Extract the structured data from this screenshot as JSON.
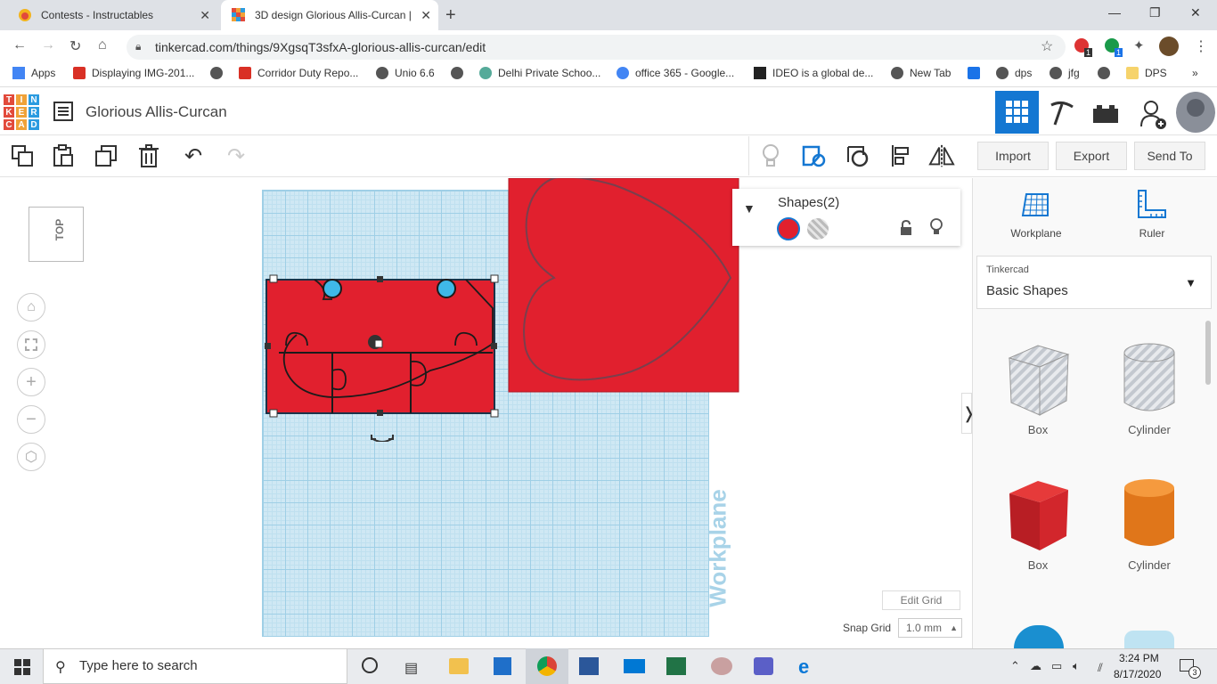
{
  "browser": {
    "tabs": [
      {
        "title": "Contests - Instructables",
        "active": false
      },
      {
        "title": "3D design Glorious Allis-Curcan |",
        "active": true
      }
    ],
    "url": "tinkercad.com/things/9XgsqT3sfxA-glorious-allis-curcan/edit",
    "bookmarks": [
      "Apps",
      "Displaying IMG-201...",
      "Corridor Duty Repo...",
      "Unio 6.6",
      "Delhi Private Schoo...",
      "office 365 - Google...",
      "IDEO is a global de...",
      "New Tab",
      "dps",
      "jfg",
      "DPS"
    ],
    "badges": [
      "1",
      "1"
    ]
  },
  "app": {
    "logo_letters": [
      "T",
      "I",
      "N",
      "K",
      "E",
      "R",
      "C",
      "A",
      "D"
    ],
    "logo_colors": [
      "#e24a3b",
      "#f0a238",
      "#2b9be0",
      "#e24a3b",
      "#f0a238",
      "#2b9be0",
      "#e24a3b",
      "#f0a238",
      "#2b9be0"
    ],
    "design_title": "Glorious Allis-Curcan",
    "accent": "#1477d2"
  },
  "toolbar": {
    "import_label": "Import",
    "export_label": "Export",
    "send_to_label": "Send To"
  },
  "canvas": {
    "view_label": "TOP",
    "workplane_label": "Workplane",
    "edit_grid_label": "Edit Grid",
    "snap_grid_label": "Snap Grid",
    "snap_grid_value": "1.0 mm"
  },
  "inspector": {
    "title": "Shapes(2)",
    "solid_color": "#e1202e"
  },
  "panel": {
    "workplane_label": "Workplane",
    "ruler_label": "Ruler",
    "library_source": "Tinkercad",
    "library_name": "Basic Shapes",
    "shapes": [
      {
        "label": "Box",
        "kind": "hole-box"
      },
      {
        "label": "Cylinder",
        "kind": "hole-cylinder"
      },
      {
        "label": "Box",
        "kind": "box"
      },
      {
        "label": "Cylinder",
        "kind": "cylinder"
      }
    ]
  },
  "taskbar": {
    "search_placeholder": "Type here to search",
    "time": "3:24 PM",
    "date": "8/17/2020",
    "notifications": "3"
  }
}
